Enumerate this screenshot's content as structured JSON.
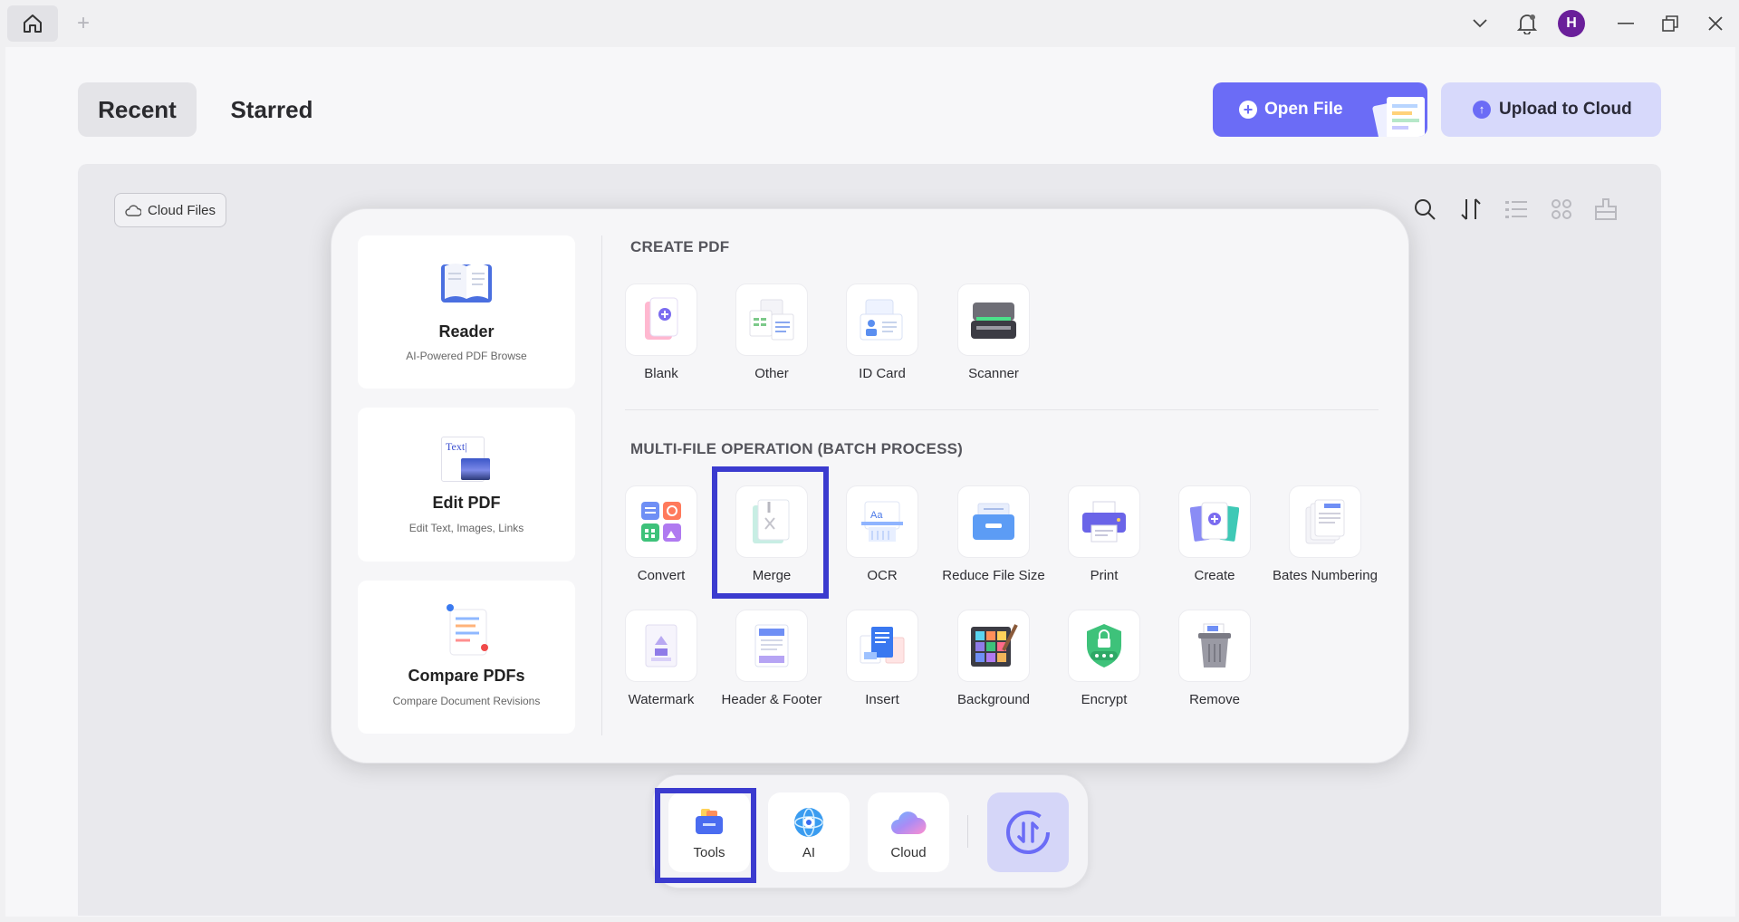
{
  "titlebar": {
    "home_icon": "home-icon",
    "new_tab_icon": "plus-icon",
    "avatar_initial": "H"
  },
  "header": {
    "tabs": [
      {
        "label": "Recent",
        "active": true
      },
      {
        "label": "Starred",
        "active": false
      }
    ],
    "open_file_label": "Open File",
    "upload_label": "Upload to Cloud"
  },
  "content": {
    "cloud_files_label": "Cloud Files"
  },
  "popup": {
    "left_cards": [
      {
        "title": "Reader",
        "subtitle": "AI-Powered PDF Browse"
      },
      {
        "title": "Edit PDF",
        "subtitle": "Edit Text, Images, Links"
      },
      {
        "title": "Compare PDFs",
        "subtitle": "Compare Document Revisions"
      }
    ],
    "create_title": "CREATE PDF",
    "create_tools": [
      "Blank",
      "Other",
      "ID Card",
      "Scanner"
    ],
    "batch_title": "MULTI-FILE OPERATION (BATCH PROCESS)",
    "batch_tools_row1": [
      "Convert",
      "Merge",
      "OCR",
      "Reduce File Size",
      "Print",
      "Create",
      "Bates Numbering"
    ],
    "batch_tools_row2": [
      "Watermark",
      "Header & Footer",
      "Insert",
      "Background",
      "Encrypt",
      "Remove"
    ],
    "edit_icon_text": "Text|"
  },
  "dock": {
    "items": [
      "Tools",
      "AI",
      "Cloud"
    ]
  },
  "colors": {
    "accent": "#6b6cf6",
    "highlight": "#3b3bcf",
    "avatar": "#6a1f9a"
  }
}
